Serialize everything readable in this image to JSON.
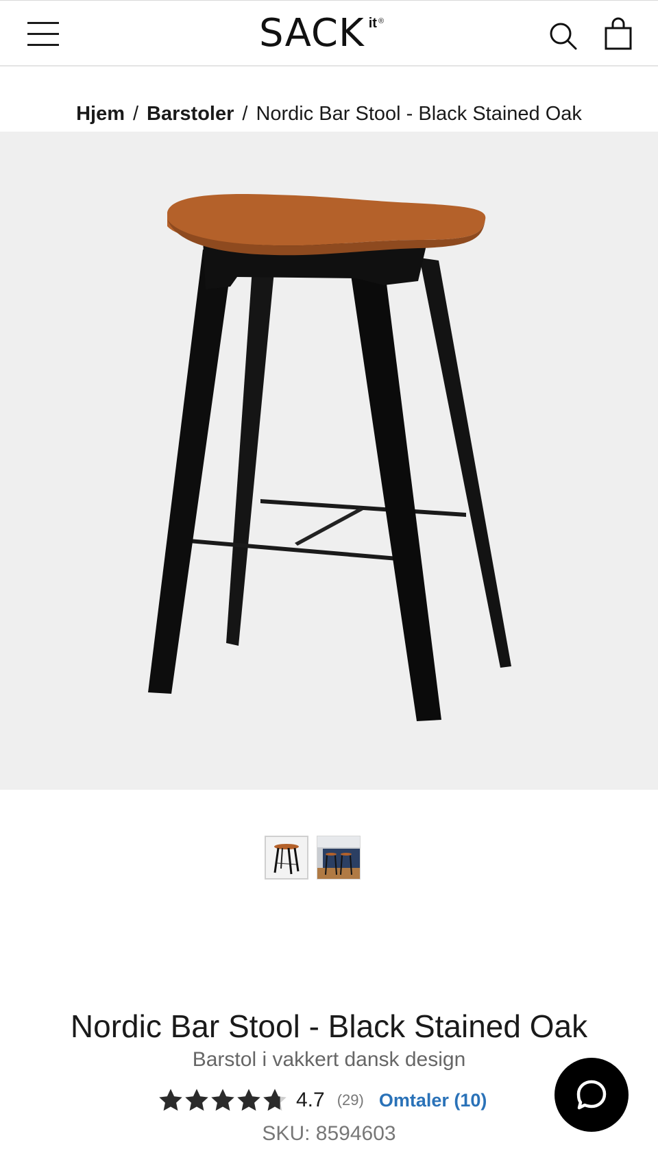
{
  "header": {
    "logo_main": "SACK",
    "logo_sup": "it",
    "logo_reg": "®",
    "menu_icon": "hamburger-menu-icon",
    "search_icon": "search-icon",
    "cart_icon": "shopping-bag-icon"
  },
  "breadcrumb": {
    "items": [
      "Hjem",
      "Barstoler"
    ],
    "separator": "/",
    "current": "Nordic Bar Stool - Black Stained Oak"
  },
  "gallery": {
    "main_image": "bar-stool-product-image",
    "thumbnails": [
      "stool-thumbnail",
      "kitchen-scene-thumbnail"
    ]
  },
  "product": {
    "title": "Nordic Bar Stool - Black Stained Oak",
    "subtitle": "Barstol i vakkert dansk design",
    "rating_value": "4.7",
    "rating_count": "(29)",
    "rating_stars": 4.7,
    "reviews_link": "Omtaler (10)",
    "sku": "SKU: 8594603"
  },
  "chat": {
    "icon": "chat-bubble-icon"
  },
  "colors": {
    "accent_link": "#2a72b8",
    "hero_bg": "#efefef",
    "seat": "#b4612a",
    "frame": "#111111",
    "star": "#2b2b2b"
  }
}
